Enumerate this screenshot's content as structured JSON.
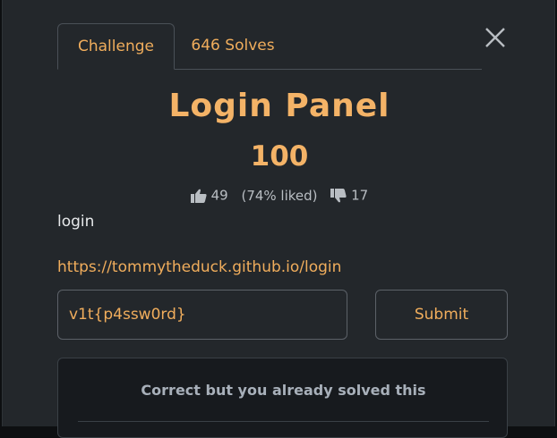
{
  "tabs": [
    {
      "label": "Challenge",
      "active": true
    },
    {
      "label": "646 Solves",
      "active": false
    }
  ],
  "challenge": {
    "title": "Login Panel",
    "points": "100",
    "likes": "49",
    "liked_percent": "(74% liked)",
    "dislikes": "17",
    "description": "login",
    "link": "https://tommytheduck.github.io/login"
  },
  "flag_input": {
    "value": "v1t{p4ssw0rd}"
  },
  "submit_label": "Submit",
  "result_message": "Correct but you already solved this",
  "icons": {
    "close": "close-icon",
    "like": "thumbs-up-icon",
    "dislike": "thumbs-down-icon"
  },
  "colors": {
    "accent": "#f0ad5c",
    "background": "#23272b",
    "page": "#0d0f11"
  }
}
